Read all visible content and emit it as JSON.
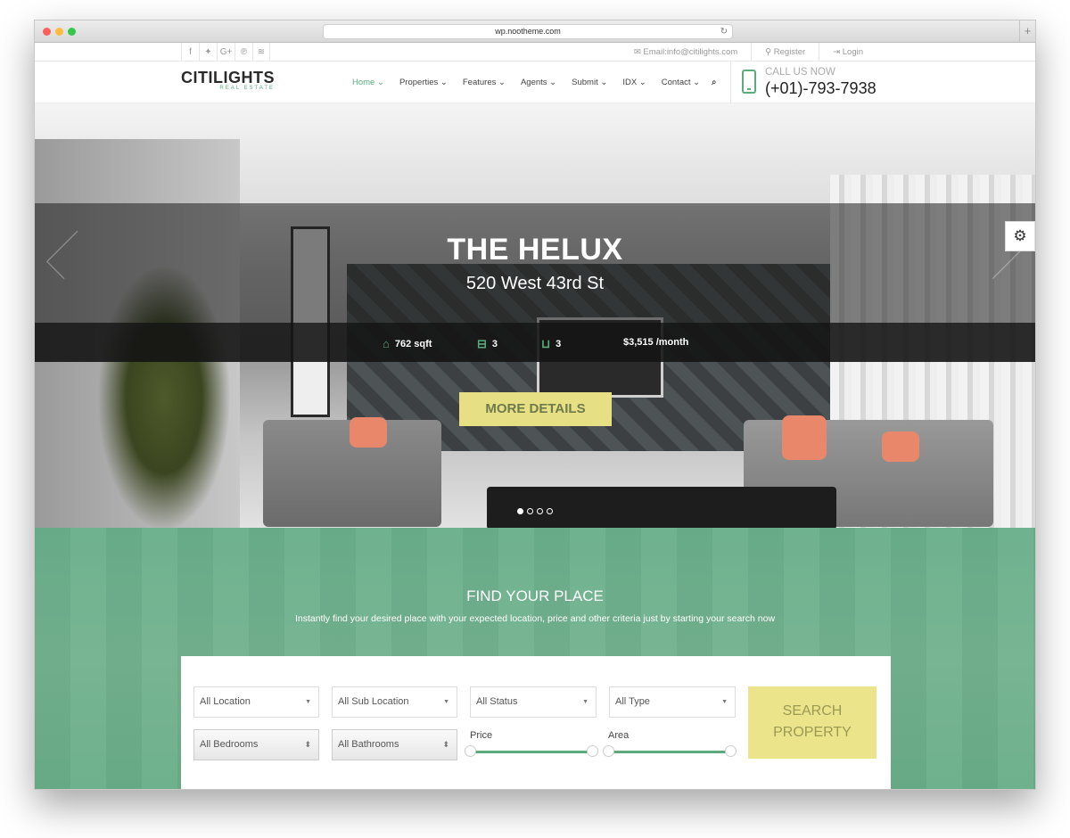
{
  "browser": {
    "url": "wp.nootheme.com"
  },
  "topbar": {
    "social": [
      "f",
      "✦",
      "G+",
      "℗",
      "≋"
    ],
    "email": "✉ Email:info@citilights.com",
    "register": "⚲ Register",
    "login": "⇥ Login"
  },
  "logo": {
    "main": "CITILIGHTS",
    "sub": "REAL ESTATE"
  },
  "nav": {
    "items": [
      "Home ⌄",
      "Properties ⌄",
      "Features ⌄",
      "Agents ⌄",
      "Submit ⌄",
      "IDX ⌄",
      "Contact ⌄"
    ],
    "search": "⌕"
  },
  "call": {
    "label": "CALL US NOW",
    "number": "(+01)-793-7938"
  },
  "hero": {
    "title": "THE HELUX",
    "address": "520 West 43rd St",
    "stats": {
      "area": "762 sqft",
      "bedrooms": "3",
      "bathrooms": "3",
      "price": "$3,515 /month"
    },
    "button": "MORE DETAILS",
    "gear": "⚙",
    "slide_count": 4,
    "active_slide": 1
  },
  "find": {
    "title": "FIND YOUR PLACE",
    "subtitle": "Instantly find your desired place with your expected location, price and other criteria just by starting your search now",
    "location": "All Location",
    "sub_location": "All Sub Location",
    "status": "All Status",
    "type": "All Type",
    "bedrooms": "All Bedrooms",
    "bathrooms": "All Bathrooms",
    "price_label": "Price",
    "area_label": "Area",
    "search_button_line1": "SEARCH",
    "search_button_line2": "PROPERTY"
  },
  "colors": {
    "accent": "#5cab7d",
    "button": "#e7df83",
    "search_bg": "#6ab08c"
  }
}
